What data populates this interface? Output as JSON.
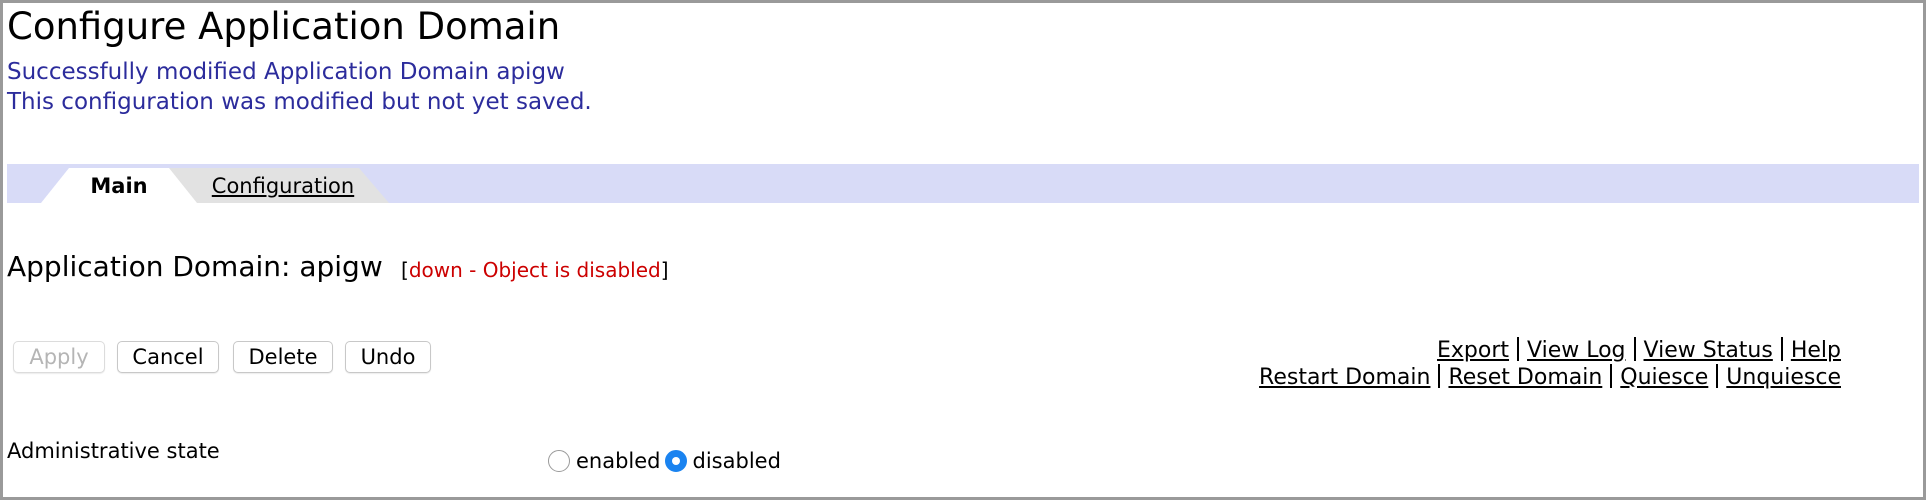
{
  "page": {
    "title": "Configure Application Domain",
    "messages": [
      "Successfully modified Application Domain apigw",
      "This configuration was modified but not yet saved."
    ]
  },
  "tabs": [
    {
      "label": "Main",
      "active": true
    },
    {
      "label": "Configuration",
      "active": false
    }
  ],
  "object": {
    "title": "Application Domain: apigw",
    "status_open": "[",
    "status_text": "down - Object is disabled",
    "status_close": "]",
    "status_color": "#cc0000"
  },
  "buttons": {
    "apply": "Apply",
    "cancel": "Cancel",
    "delete": "Delete",
    "undo": "Undo"
  },
  "links": {
    "export": "Export",
    "view_log": "View Log",
    "view_status": "View Status",
    "help": "Help",
    "restart_domain": "Restart Domain",
    "reset_domain": "Reset Domain",
    "quiesce": "Quiesce",
    "unquiesce": "Unquiesce"
  },
  "admin_state": {
    "label": "Administrative state",
    "options": [
      "enabled",
      "disabled"
    ],
    "selected": "disabled"
  },
  "colors": {
    "message": "#2c2c9c",
    "tab_bar": "#d8dbf7",
    "radio_checked": "#1a83f0"
  }
}
